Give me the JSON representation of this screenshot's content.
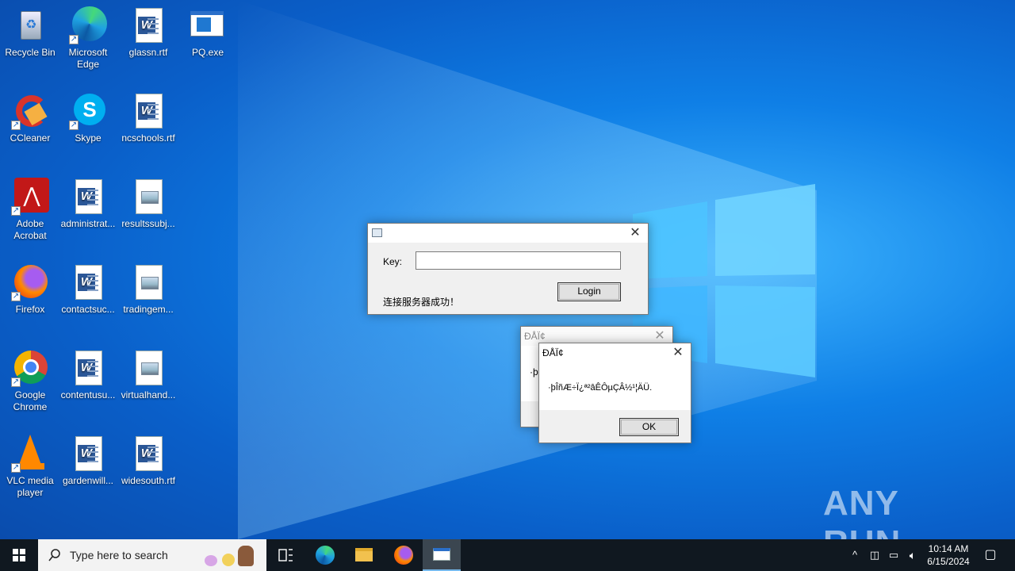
{
  "desktop": {
    "icons": [
      {
        "label": "Recycle Bin",
        "type": "recycle"
      },
      {
        "label": "Microsoft Edge",
        "type": "edge"
      },
      {
        "label": "glassn.rtf",
        "type": "word"
      },
      {
        "label": "PQ.exe",
        "type": "exe"
      },
      {
        "label": "CCleaner",
        "type": "ccleaner"
      },
      {
        "label": "Skype",
        "type": "skype"
      },
      {
        "label": "ncschools.rtf",
        "type": "word"
      },
      {
        "label": "Adobe Acrobat",
        "type": "acrobat"
      },
      {
        "label": "administrat...",
        "type": "word"
      },
      {
        "label": "resultssubj...",
        "type": "image"
      },
      {
        "label": "Firefox",
        "type": "firefox"
      },
      {
        "label": "contactsuc...",
        "type": "word"
      },
      {
        "label": "tradingem...",
        "type": "image"
      },
      {
        "label": "Google Chrome",
        "type": "chrome"
      },
      {
        "label": "contentusu...",
        "type": "word"
      },
      {
        "label": "virtualhand...",
        "type": "image"
      },
      {
        "label": "VLC media player",
        "type": "vlc"
      },
      {
        "label": "gardenwill...",
        "type": "word"
      },
      {
        "label": "widesouth.rtf",
        "type": "word"
      }
    ]
  },
  "login_dialog": {
    "key_label": "Key:",
    "key_value": "",
    "login_button": "Login",
    "status_text": "连接服务器成功！",
    "close_glyph": "✕"
  },
  "bg_dialog": {
    "title": "ÐÅÏ¢",
    "body_partial": "·þ"
  },
  "message_dialog": {
    "title": "ÐÅÏ¢",
    "message": "·þÎñÆ÷Ï¿ª²âÊÔµÇÂ½¹¦ÄÜ.",
    "ok_button": "OK"
  },
  "taskbar": {
    "search_placeholder": "Type here to search",
    "time": "10:14 AM",
    "date": "6/15/2024"
  },
  "watermark": "ANY RUN"
}
